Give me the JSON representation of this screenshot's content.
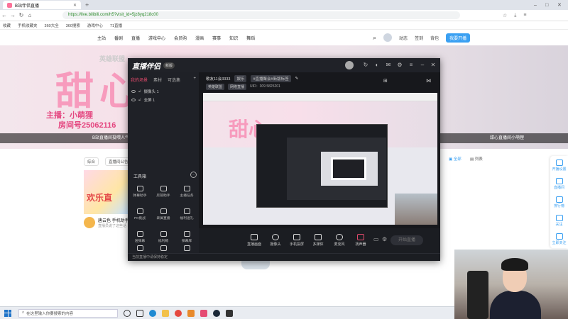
{
  "browser": {
    "tab_title": "B站伴侣直播",
    "url": "https://live.bilibili.com/h5?visit_id=5jz8yq218c00",
    "bookmarks": [
      "收藏",
      "手机收藏夹",
      "360大全",
      "360搜索",
      "游戏中心",
      "71直播"
    ]
  },
  "bilibili_nav": {
    "items": [
      "主站",
      "番剧",
      "直播",
      "游戏中心",
      "会员购",
      "漫画",
      "赛事",
      "知识",
      "舞蹈"
    ],
    "right_items": [
      "动态",
      "签到",
      "背包"
    ],
    "live_button": "我要开播"
  },
  "banner": {
    "top_text": "英雄联盟",
    "big_text": "甜心",
    "host": "主播：小萌狸",
    "room": "房间号25062116",
    "bar_text": "B站直播间投喂人气主播，来一起看直播吧",
    "bar_right": "甜心直播间小萌狸"
  },
  "below": {
    "chips": [
      "综合",
      "直播间公告"
    ],
    "card_title": "欢乐直",
    "user_name": "唐云色 手机助手",
    "user_sub": "直播员说了这些话"
  },
  "right_sidebar": [
    "开播设置",
    "直播间",
    "排行榜",
    "关注",
    "立即关注"
  ],
  "app": {
    "logo": "直播伴侣",
    "version": "新版",
    "left_tabs": [
      "我的场景",
      "素材",
      "可选集"
    ],
    "sources": [
      "摄像头 1",
      "全屏 1"
    ],
    "tools_title": "工具箱",
    "tools": [
      "弹幕助手",
      "房管助手",
      "主播任务",
      "PK挑战",
      "录屏直播",
      "福利送礼",
      "送弹幕",
      "福利箱",
      "弹幕库",
      "投票",
      "互动玩法",
      "更多"
    ],
    "info_title": "歌友11会3333",
    "info_tags": [
      "娱乐",
      "#直播聚会#新版标签"
    ],
    "info_line2": [
      "英雄联盟",
      "网络直播",
      "UID：309 5825201"
    ],
    "bottom_buttons": [
      "直播画面",
      "摄像头",
      "手机投屏",
      "多媒体",
      "麦克风",
      "扬声器"
    ],
    "start_button": "开始直播",
    "status": "当前直播中请保持稳定"
  },
  "taskbar": {
    "search_placeholder": "在这里输入你要搜索的内容"
  },
  "colors": {
    "accent_pink": "#fb7299",
    "accent_blue": "#3aa0f2",
    "app_dark": "#1b1d22"
  }
}
